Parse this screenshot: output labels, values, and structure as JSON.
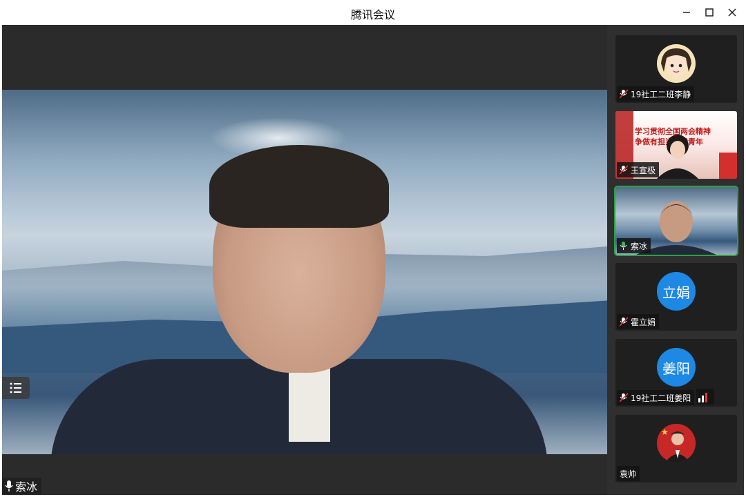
{
  "window": {
    "title": "腾讯会议",
    "controls": [
      "minimize",
      "maximize",
      "close"
    ]
  },
  "main_speaker": {
    "name": "索冰"
  },
  "participants": [
    {
      "name": "19社工二班李静",
      "muted": true,
      "avatar": "cartoon-girl"
    },
    {
      "name": "王宣极",
      "muted": true,
      "background_text": [
        "学习贯彻全国两会精神",
        "争做有担当时代青年"
      ]
    },
    {
      "name": "索冰",
      "muted": false,
      "active": true
    },
    {
      "name": "霍立娟",
      "muted": true,
      "avatar_text": "立娟",
      "avatar_color": "#1e88e5"
    },
    {
      "name": "19社工二班姜阳",
      "muted": true,
      "avatar_text": "姜阳",
      "avatar_color": "#1e88e5",
      "signal_bars": 3
    },
    {
      "name": "袁帅",
      "muted": false
    }
  ]
}
